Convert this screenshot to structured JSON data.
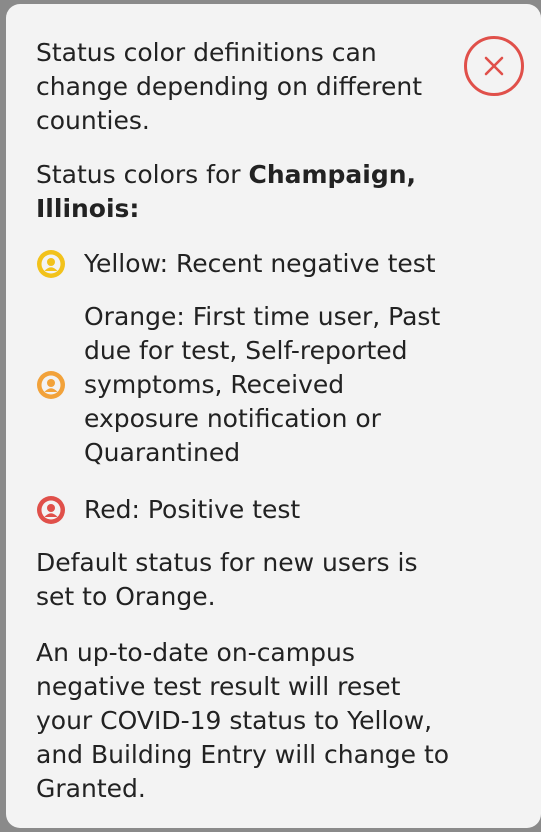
{
  "colors": {
    "close": "#e0504a",
    "yellow": "#f2c21b",
    "orange": "#f2a23a",
    "red": "#e0504a"
  },
  "close_icon": "close-icon",
  "intro": {
    "line1": "Status color definitions can",
    "line2": "change depending on different",
    "line3": "counties."
  },
  "location": {
    "prefix": "Status colors for ",
    "bold1": "Champaign,",
    "bold2": "Illinois:"
  },
  "statuses": [
    {
      "icon": "person-circle-icon",
      "lines": [
        "Yellow: Recent negative test"
      ]
    },
    {
      "icon": "person-circle-icon",
      "lines": [
        "Orange: First time user, Past",
        "due for test, Self-reported",
        "symptoms, Received",
        "exposure notification or",
        "Quarantined"
      ]
    },
    {
      "icon": "person-circle-icon",
      "lines": [
        "Red: Positive test"
      ]
    }
  ],
  "default_note": {
    "line1": "Default status for new users is",
    "line2": "set to Orange."
  },
  "reset_note": {
    "line1": "An up-to-date on-campus",
    "line2": "negative test result will reset",
    "line3": "your COVID-19 status to Yellow,",
    "line4": "and Building Entry will change to",
    "line5": "Granted."
  }
}
